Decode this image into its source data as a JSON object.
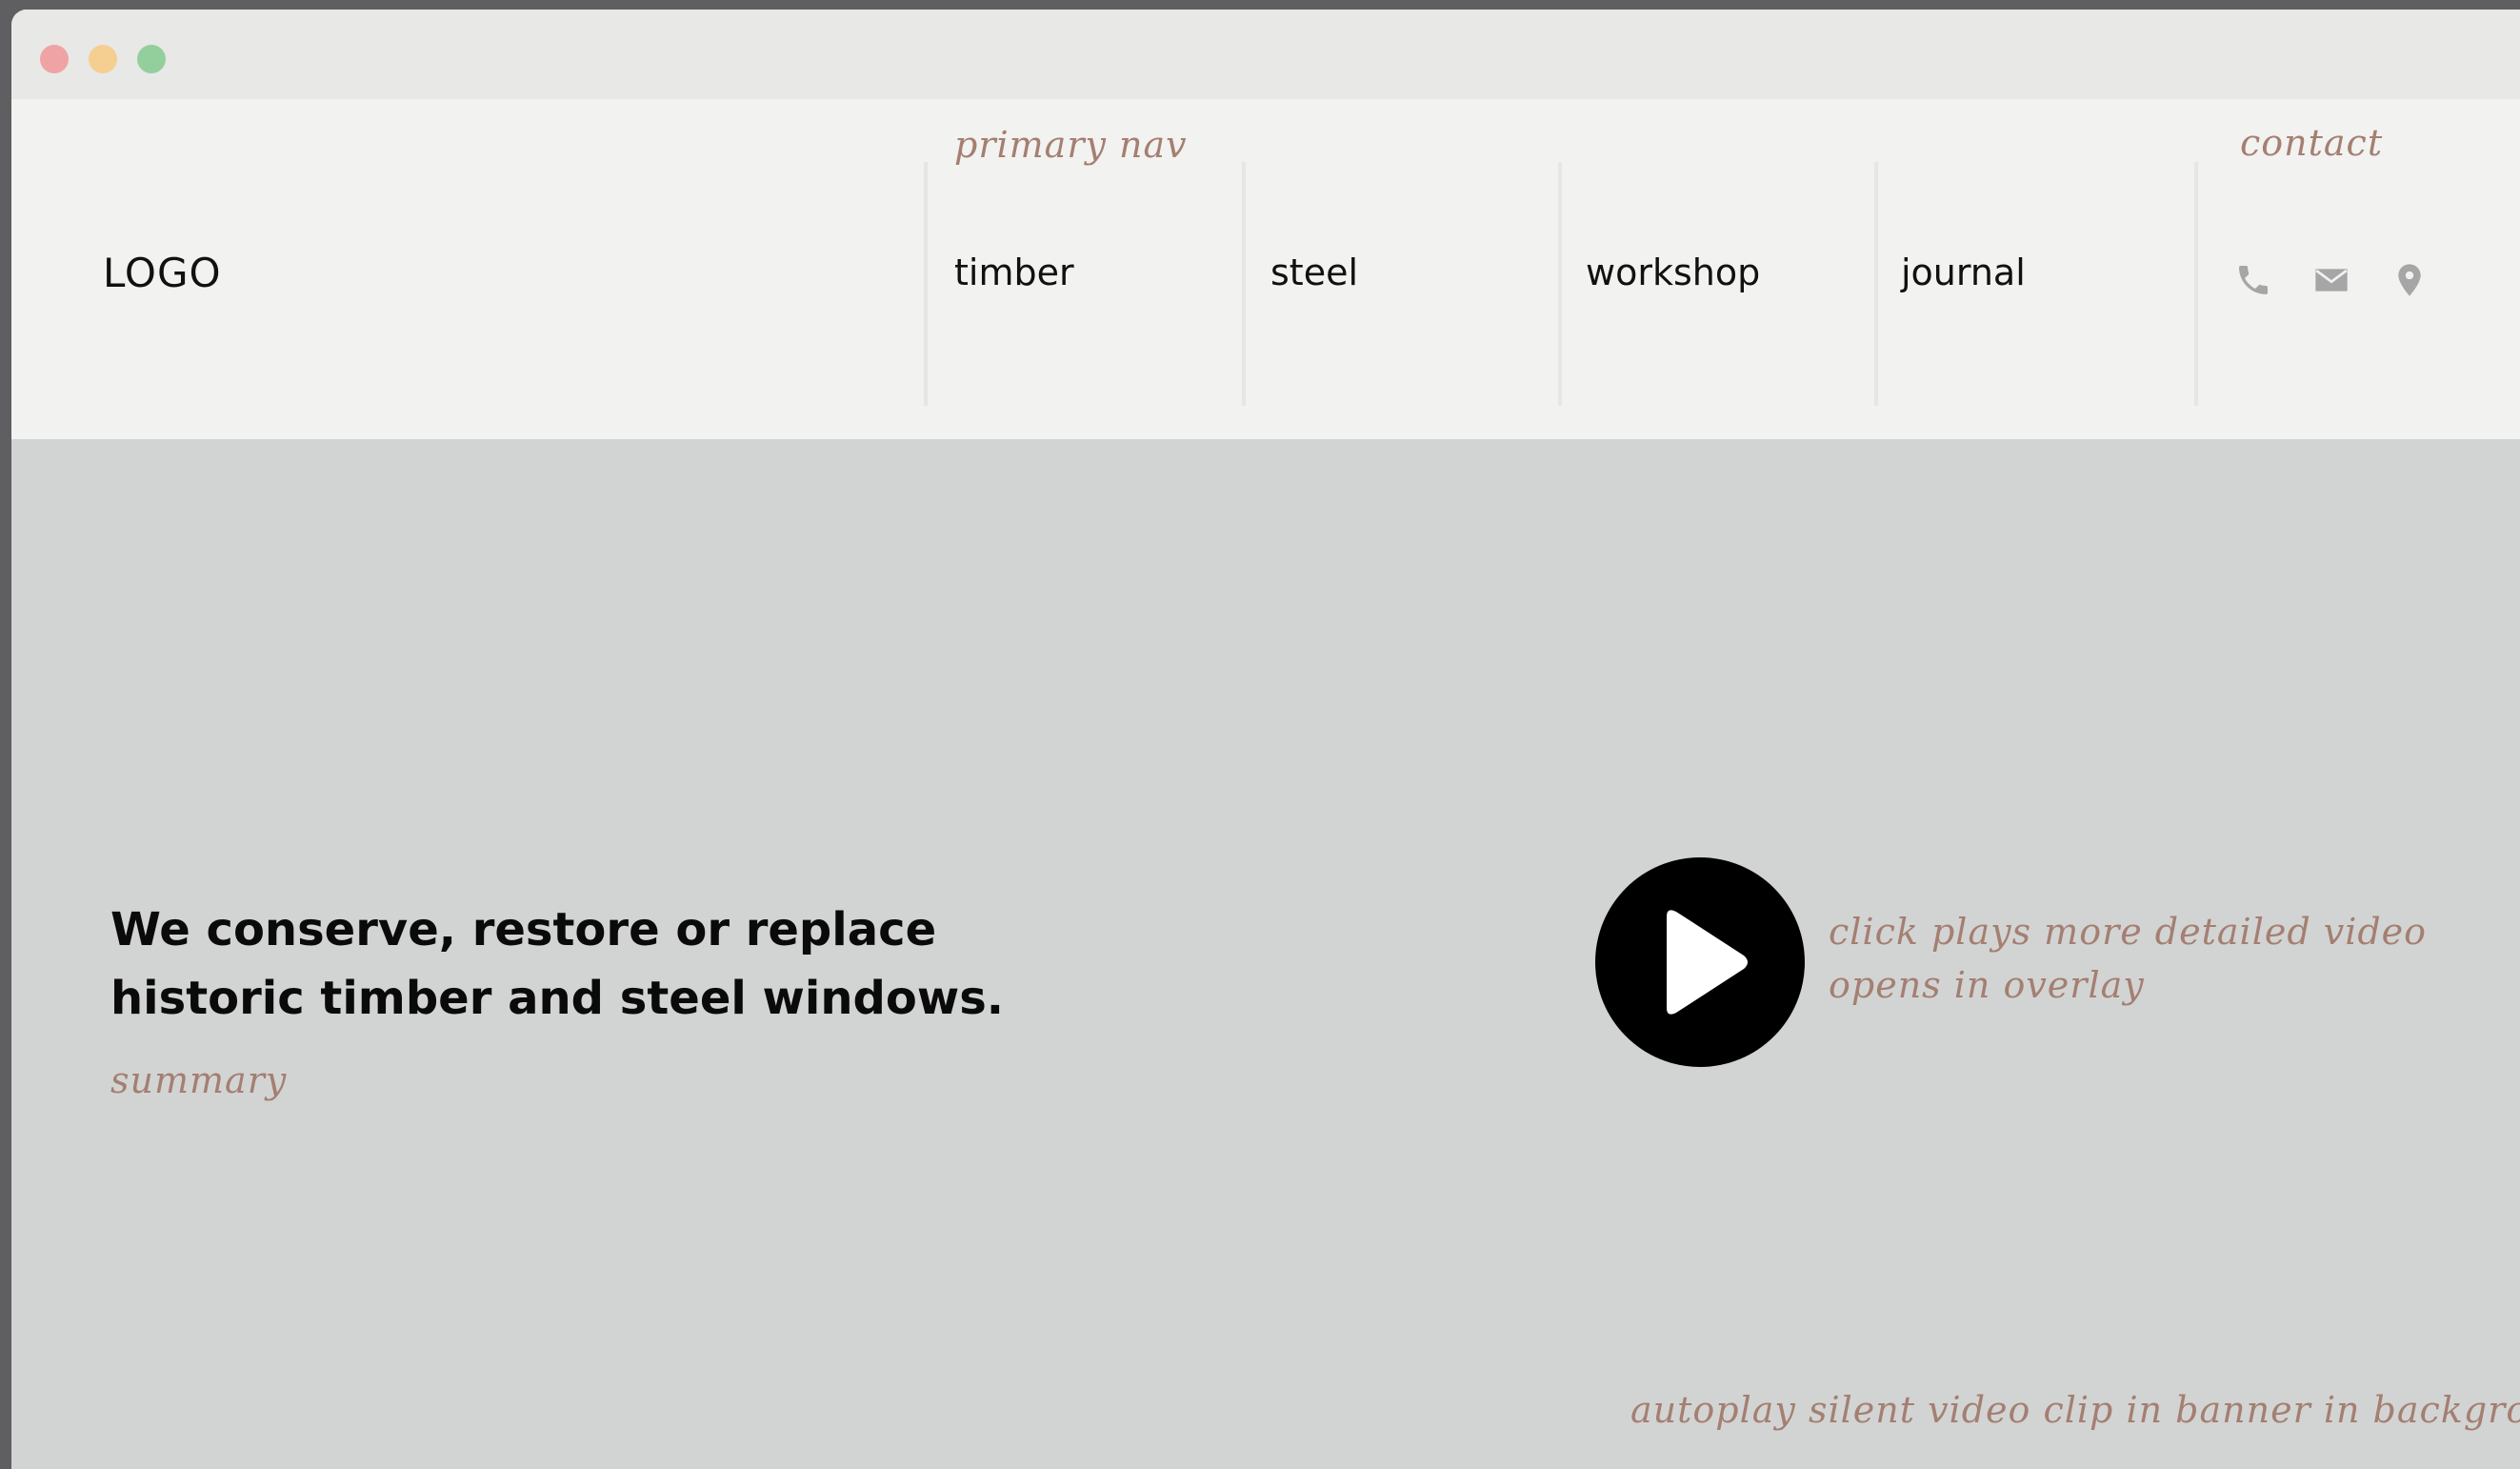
{
  "window": {
    "controls": {
      "close_color": "#f0a3a4",
      "minimize_color": "#f5cf91",
      "maximize_color": "#93cf9d"
    }
  },
  "header": {
    "logo": "LOGO",
    "primary_nav_note": "primary nav",
    "contact_note": "contact",
    "nav_items": [
      {
        "label": "timber"
      },
      {
        "label": "steel"
      },
      {
        "label": "workshop"
      },
      {
        "label": "journal"
      }
    ],
    "contact_icons": [
      "phone-icon",
      "email-icon",
      "location-icon"
    ]
  },
  "banner": {
    "headline": "We conserve, restore or replace historic timber and steel windows.",
    "summary_note": "summary",
    "video_note": "click plays more detailed video opens in overlay",
    "autoplay_note": "autoplay silent video clip in banner in background",
    "play_icon": "play-icon"
  },
  "colors": {
    "annotation": "#a47f72",
    "header_bg": "#f2f2f0",
    "banner_bg": "#d2d4d3"
  }
}
